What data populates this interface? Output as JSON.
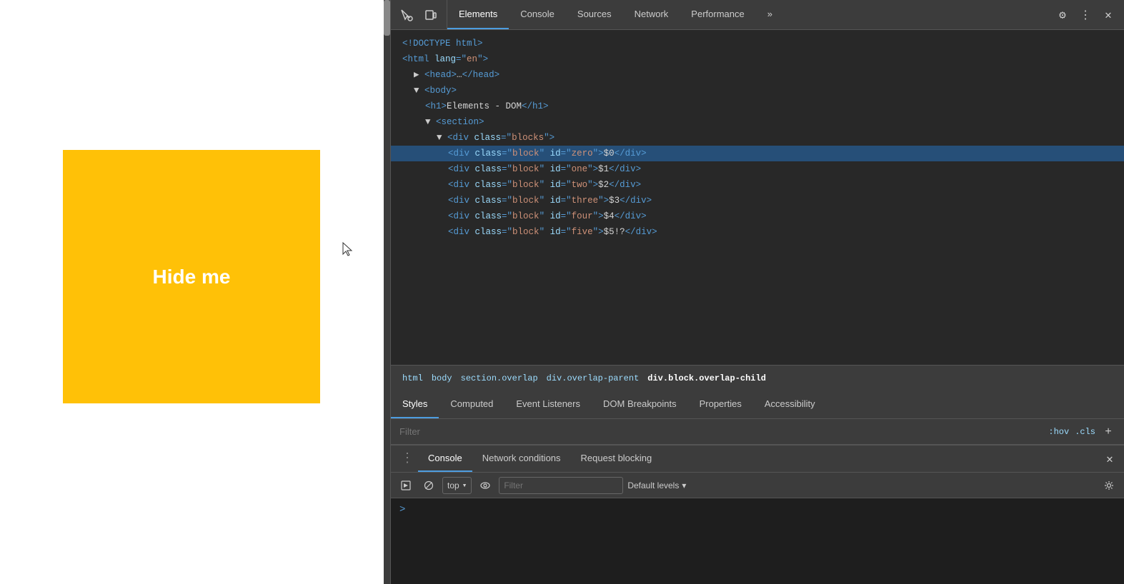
{
  "webpage": {
    "yellow_box_text": "Hide me"
  },
  "devtools": {
    "toolbar": {
      "tabs": [
        {
          "label": "Elements",
          "active": true
        },
        {
          "label": "Console",
          "active": false
        },
        {
          "label": "Sources",
          "active": false
        },
        {
          "label": "Network",
          "active": false
        },
        {
          "label": "Performance",
          "active": false
        }
      ],
      "more_tabs_label": "»",
      "settings_label": "⚙",
      "more_options_label": "⋮",
      "close_label": "✕"
    },
    "dom": {
      "lines": [
        {
          "indent": 0,
          "html": "<!DOCTYPE html>"
        },
        {
          "indent": 0,
          "html": "<html lang=\"en\">"
        },
        {
          "indent": 1,
          "html": "▶ <head>…</head>"
        },
        {
          "indent": 1,
          "html": "▼ <body>"
        },
        {
          "indent": 2,
          "html": "<h1>Elements - DOM</h1>"
        },
        {
          "indent": 2,
          "html": "▼ <section>"
        },
        {
          "indent": 3,
          "html": "▼ <div class=\"blocks\">"
        },
        {
          "indent": 4,
          "html": "<div class=\"block\" id=\"zero\">$0</div>"
        },
        {
          "indent": 4,
          "html": "<div class=\"block\" id=\"one\">$1</div>"
        },
        {
          "indent": 4,
          "html": "<div class=\"block\" id=\"two\">$2</div>"
        },
        {
          "indent": 4,
          "html": "<div class=\"block\" id=\"three\">$3</div>"
        },
        {
          "indent": 4,
          "html": "<div class=\"block\" id=\"four\">$4</div>"
        },
        {
          "indent": 4,
          "html": "<div class=\"block\" id=\"five\">$5!?</div>"
        }
      ]
    },
    "breadcrumb": {
      "items": [
        {
          "label": "html",
          "active": false
        },
        {
          "label": "body",
          "active": false
        },
        {
          "label": "section.overlap",
          "active": false
        },
        {
          "label": "div.overlap-parent",
          "active": false
        },
        {
          "label": "div.block.overlap-child",
          "active": true
        }
      ]
    },
    "styles_tabs": [
      {
        "label": "Styles",
        "active": true
      },
      {
        "label": "Computed",
        "active": false
      },
      {
        "label": "Event Listeners",
        "active": false
      },
      {
        "label": "DOM Breakpoints",
        "active": false
      },
      {
        "label": "Properties",
        "active": false
      },
      {
        "label": "Accessibility",
        "active": false
      }
    ],
    "filter": {
      "placeholder": "Filter",
      "hov_label": ":hov",
      "cls_label": ".cls",
      "plus_label": "+"
    },
    "console_panel": {
      "tabs": [
        {
          "label": "Console",
          "active": true
        },
        {
          "label": "Network conditions",
          "active": false
        },
        {
          "label": "Request blocking",
          "active": false
        }
      ],
      "close_label": "✕",
      "toolbar": {
        "execute_label": "▶",
        "block_label": "🚫",
        "context_value": "top",
        "context_arrow": "▾",
        "eye_label": "👁",
        "filter_placeholder": "Filter",
        "default_levels_label": "Default levels",
        "default_levels_arrow": "▾",
        "settings_label": "⚙"
      },
      "prompt_label": ">"
    }
  }
}
